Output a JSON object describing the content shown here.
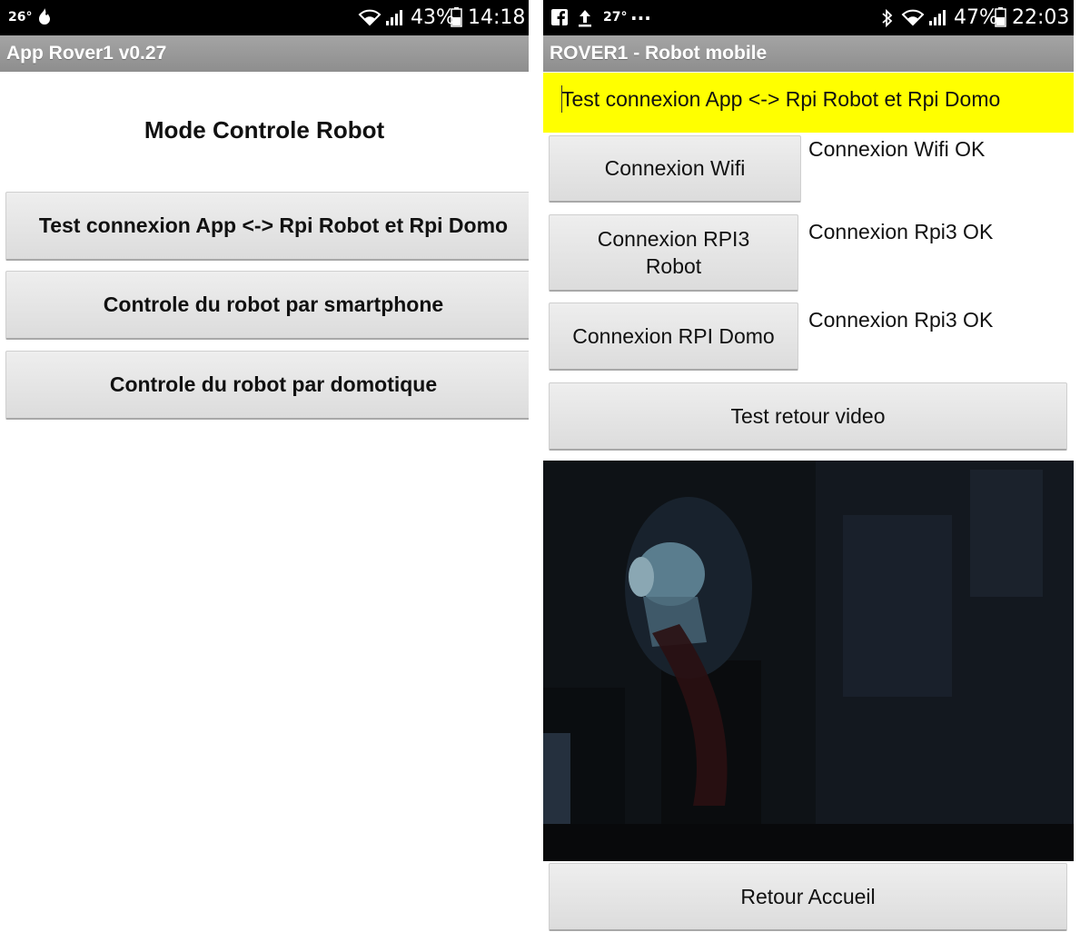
{
  "left_screen": {
    "status_bar": {
      "temperature": "26°",
      "battery_percent": "43%",
      "time": "14:18",
      "icons": [
        "fire-icon",
        "wifi-icon",
        "signal-icon",
        "battery-icon"
      ]
    },
    "app_title": "App Rover1 v0.27",
    "heading": "Mode Controle Robot",
    "buttons": [
      "Test connexion App <-> Rpi Robot et Rpi Domo",
      "Controle du robot par smartphone",
      "Controle du robot par domotique"
    ]
  },
  "right_screen": {
    "status_bar": {
      "temperature": "27°",
      "overflow": "...",
      "battery_percent": "47%",
      "time": "22:03",
      "icons": [
        "facebook-icon",
        "upload-icon",
        "bluetooth-icon",
        "wifi-icon",
        "signal-icon",
        "battery-icon"
      ]
    },
    "app_title": "ROVER1 - Robot mobile",
    "banner": "Test connexion App <-> Rpi Robot et Rpi Domo",
    "connections": [
      {
        "button": "Connexion Wifi",
        "status": "Connexion Wifi OK"
      },
      {
        "button_line1": "Connexion RPI3",
        "button_line2": "Robot",
        "status": "Connexion Rpi3 OK"
      },
      {
        "button": "Connexion RPI Domo",
        "status": "Connexion Rpi3 OK"
      }
    ],
    "video_button": "Test retour video",
    "home_button": "Retour Accueil"
  },
  "colors": {
    "appbar": "#999999",
    "banner": "#ffff00",
    "button": "#e4e4e4",
    "statusbar": "#000000"
  }
}
